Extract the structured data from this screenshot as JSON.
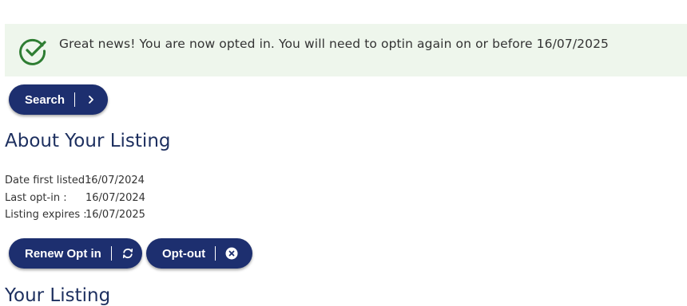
{
  "alert": {
    "message": "Great news! You are now opted in. You will need to optin again on or before 16/07/2025",
    "icon": "check-circle-icon",
    "icon_color": "#2e7d32",
    "background": "#eef6ec"
  },
  "search_button": {
    "label": "Search",
    "icon": "chevron-right-icon"
  },
  "about": {
    "title": "About Your Listing",
    "rows": [
      {
        "label": "Date first listed :",
        "value": "16/07/2024"
      },
      {
        "label": "Last opt-in :",
        "value": "16/07/2024"
      },
      {
        "label": "Listing expires :",
        "value": "16/07/2025"
      }
    ]
  },
  "actions": {
    "renew_label": "Renew Opt in",
    "renew_icon": "refresh-icon",
    "optout_label": "Opt-out",
    "optout_icon": "close-circle-icon"
  },
  "your_listing": {
    "title": "Your Listing"
  },
  "colors": {
    "button": "#1d2f6f",
    "heading": "#1d2f5f"
  }
}
